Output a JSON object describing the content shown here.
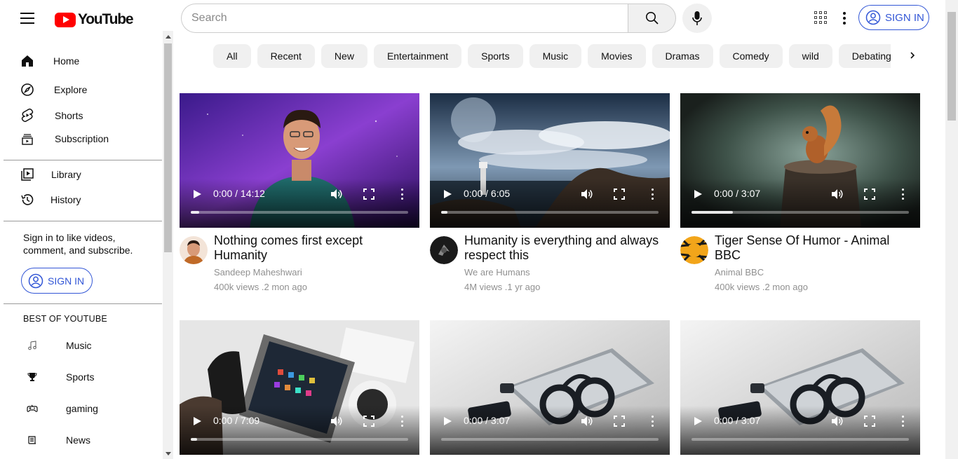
{
  "header": {
    "logo_text": "YouTube",
    "search_placeholder": "Search",
    "sign_in_label": "SIGN IN"
  },
  "sidebar": {
    "main_items": [
      {
        "label": "Home",
        "icon": "home-icon"
      },
      {
        "label": "Explore",
        "icon": "compass-icon"
      },
      {
        "label": "Shorts",
        "icon": "shorts-icon"
      },
      {
        "label": "Subscription",
        "icon": "subscription-icon"
      }
    ],
    "library_items": [
      {
        "label": "Library",
        "icon": "library-icon"
      },
      {
        "label": "History",
        "icon": "history-icon"
      }
    ],
    "signin_prompt": "Sign in to like videos, comment, and subscribe.",
    "sign_in_label": "SIGN IN",
    "best_title": "BEST OF YOUTUBE",
    "best_items": [
      {
        "label": "Music",
        "icon": "music-note-icon"
      },
      {
        "label": "Sports",
        "icon": "trophy-icon"
      },
      {
        "label": "gaming",
        "icon": "gamepad-icon"
      },
      {
        "label": "News",
        "icon": "news-icon"
      }
    ]
  },
  "chips": [
    "All",
    "Recent",
    "New",
    "Entertainment",
    "Sports",
    "Music",
    "Movies",
    "Dramas",
    "Comedy",
    "wild",
    "Debating"
  ],
  "videos": [
    {
      "title": "Nothing comes first except Humanity",
      "channel": "Sandeep Maheshwari",
      "stats": "400k views .2 mon ago",
      "time": "0:00 / 14:12",
      "progress": 0.04
    },
    {
      "title": "Humanity is everything and always respect this",
      "channel": "We are Humans",
      "stats": "4M views .1 yr ago",
      "time": "0:00 / 6:05",
      "progress": 0.03
    },
    {
      "title": "Tiger Sense Of Humor - Animal BBC",
      "channel": "Animal BBC",
      "stats": "400k views .2 mon ago",
      "time": "0:00 / 3:07",
      "progress": 0.19
    },
    {
      "title": "",
      "channel": "",
      "stats": "",
      "time": "0:00 / 7:09",
      "progress": 0.03
    },
    {
      "title": "",
      "channel": "",
      "stats": "",
      "time": "0:00 / 3:07",
      "progress": 0
    },
    {
      "title": "",
      "channel": "",
      "stats": "",
      "time": "0:00 / 3:07",
      "progress": 0
    }
  ],
  "colors": {
    "brand_red": "#ff0000",
    "link_blue": "#3256d6",
    "chip_bg": "#f0f0f0",
    "meta_gray": "#909090"
  }
}
